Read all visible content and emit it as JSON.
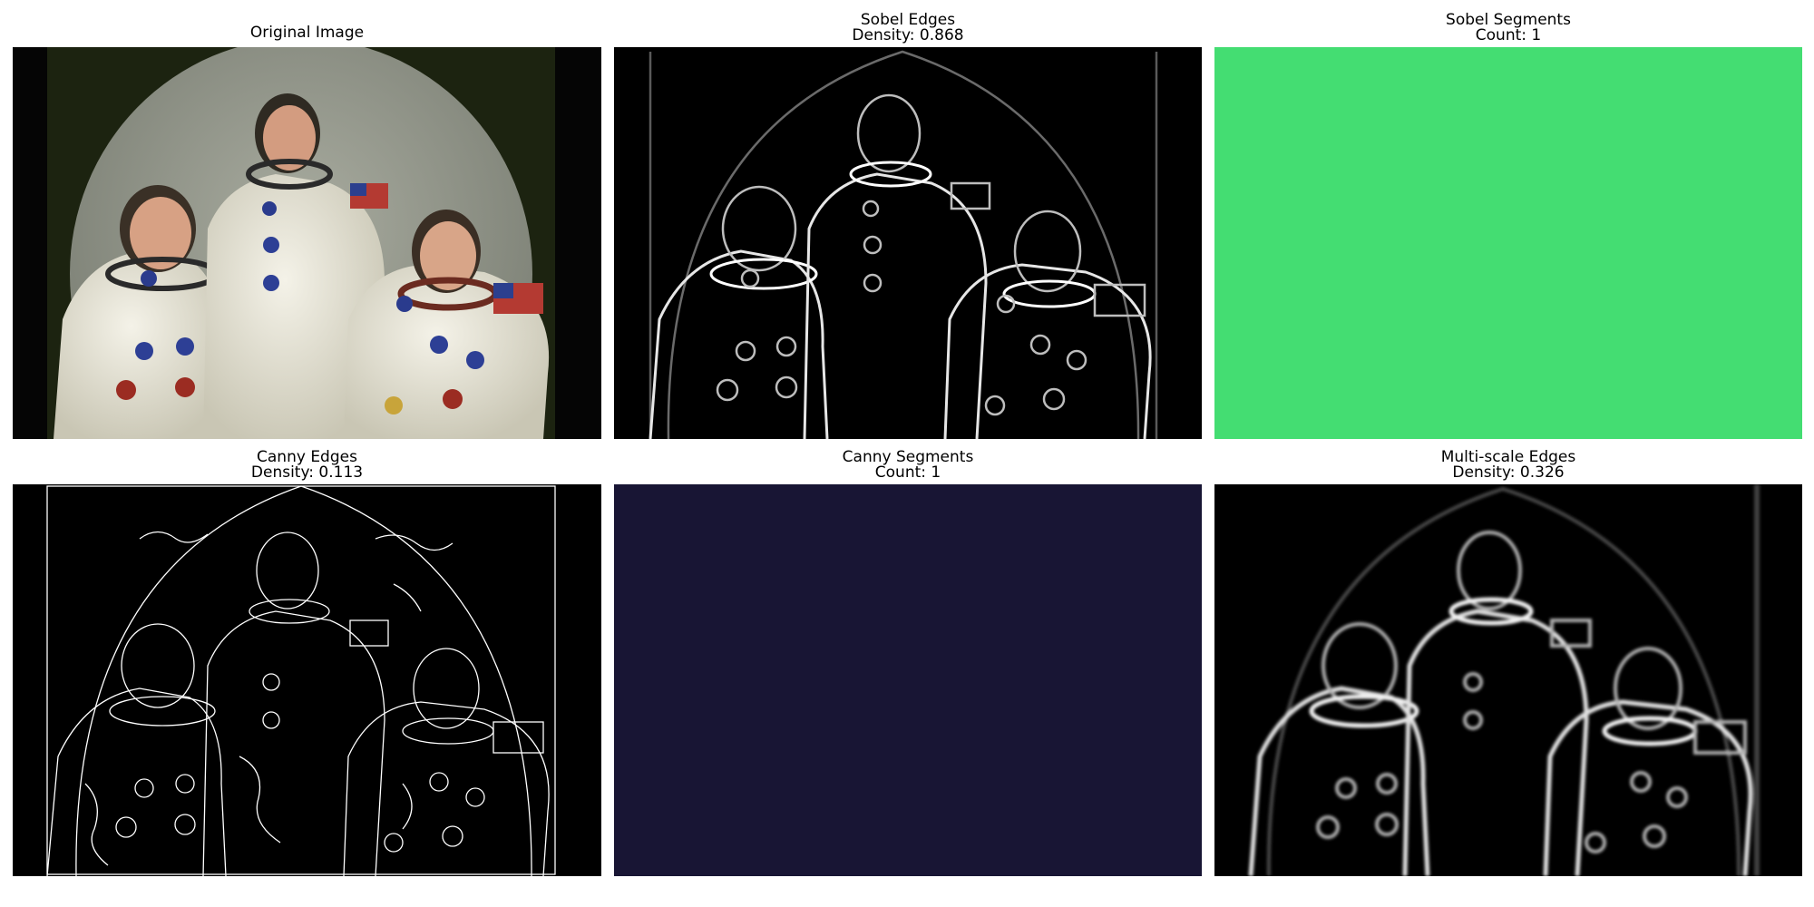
{
  "panels": [
    {
      "title": "Original Image",
      "subtitle": "",
      "kind": "photo"
    },
    {
      "title": "Sobel Edges",
      "subtitle": "Density: 0.868",
      "kind": "edge-map"
    },
    {
      "title": "Sobel Segments",
      "subtitle": "Count: 1",
      "kind": "solid",
      "fill_color": "#44dd72"
    },
    {
      "title": "Canny Edges",
      "subtitle": "Density: 0.113",
      "kind": "edge-map"
    },
    {
      "title": "Canny Segments",
      "subtitle": "Count: 1",
      "kind": "solid",
      "fill_color": "#181534"
    },
    {
      "title": "Multi-scale Edges",
      "subtitle": "Density: 0.326",
      "kind": "edge-map"
    }
  ]
}
